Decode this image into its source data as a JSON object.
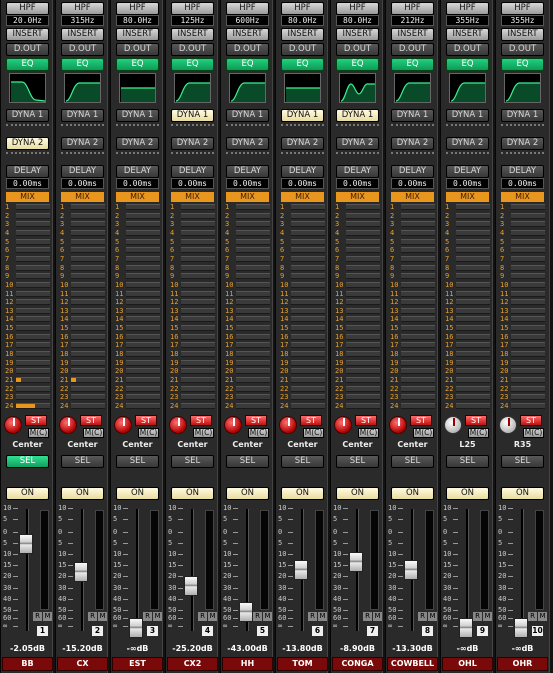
{
  "labels": {
    "hpf": "HPF",
    "insert": "INSERT",
    "dout": "D.OUT",
    "eq": "EQ",
    "dyna1": "DYNA 1",
    "dyna2": "DYNA 2",
    "delay": "DELAY",
    "mix": "MIX",
    "st": "ST",
    "mc": "M(C)",
    "sel": "SEL",
    "on": "ON",
    "r": "R",
    "m": "M"
  },
  "scale_marks": [
    "10",
    "5",
    "0",
    "5",
    "10",
    "15",
    "20",
    "30",
    "40",
    "50",
    "60",
    "∞"
  ],
  "send_numbers": [
    "1",
    "2",
    "3",
    "4",
    "5",
    "6",
    "7",
    "8",
    "9",
    "10",
    "11",
    "12",
    "13",
    "14",
    "15",
    "16",
    "17",
    "18",
    "19",
    "20",
    "21",
    "22",
    "23",
    "24"
  ],
  "colors": {
    "mix": "#e8961e",
    "eq_on": "#18b870",
    "sel_on": "#20c878",
    "st": "#e83030",
    "name_bg": "#7a0a0a"
  },
  "channels": [
    {
      "name": "BB",
      "number": "1",
      "hpf": "20.0Hz",
      "delay": "0.00ms",
      "pan": "Center",
      "level": "-2.05dB",
      "fader": 0.8,
      "eq_curve": "lowpass",
      "dyna1_on": false,
      "dyna2_on": true,
      "sel_on": true,
      "knob": "red",
      "sends": {
        "21": 0.15,
        "24": 0.55
      }
    },
    {
      "name": "CX",
      "number": "2",
      "hpf": "315Hz",
      "delay": "0.00ms",
      "pan": "Center",
      "level": "-15.20dB",
      "fader": 0.53,
      "eq_curve": "highpass",
      "dyna1_on": false,
      "dyna2_on": false,
      "sel_on": false,
      "knob": "red",
      "sends": {
        "21": 0.15
      }
    },
    {
      "name": "EST",
      "number": "3",
      "hpf": "80.0Hz",
      "delay": "0.00ms",
      "pan": "Center",
      "level": "-∞dB",
      "fader": 0.0,
      "eq_curve": "flat",
      "dyna1_on": false,
      "dyna2_on": false,
      "sel_on": false,
      "knob": "red",
      "sends": {}
    },
    {
      "name": "CX2",
      "number": "4",
      "hpf": "125Hz",
      "delay": "0.00ms",
      "pan": "Center",
      "level": "-25.20dB",
      "fader": 0.4,
      "eq_curve": "highpass",
      "dyna1_on": true,
      "dyna2_on": false,
      "sel_on": false,
      "knob": "red",
      "sends": {}
    },
    {
      "name": "HH",
      "number": "5",
      "hpf": "600Hz",
      "delay": "0.00ms",
      "pan": "Center",
      "level": "-43.00dB",
      "fader": 0.15,
      "eq_curve": "highpass",
      "dyna1_on": false,
      "dyna2_on": false,
      "sel_on": false,
      "knob": "red",
      "sends": {}
    },
    {
      "name": "TOM",
      "number": "6",
      "hpf": "80.0Hz",
      "delay": "0.00ms",
      "pan": "Center",
      "level": "-13.80dB",
      "fader": 0.55,
      "eq_curve": "flat",
      "dyna1_on": true,
      "dyna2_on": false,
      "sel_on": false,
      "knob": "red",
      "sends": {}
    },
    {
      "name": "CONGA",
      "number": "7",
      "hpf": "80.0Hz",
      "delay": "0.00ms",
      "pan": "Center",
      "level": "-8.90dB",
      "fader": 0.63,
      "eq_curve": "peak",
      "dyna1_on": true,
      "dyna2_on": false,
      "sel_on": false,
      "knob": "red",
      "sends": {}
    },
    {
      "name": "COWBELL",
      "number": "8",
      "hpf": "212Hz",
      "delay": "0.00ms",
      "pan": "Center",
      "level": "-13.30dB",
      "fader": 0.55,
      "eq_curve": "highpass",
      "dyna1_on": false,
      "dyna2_on": false,
      "sel_on": false,
      "knob": "red",
      "sends": {}
    },
    {
      "name": "OHL",
      "number": "9",
      "hpf": "355Hz",
      "delay": "0.00ms",
      "pan": "L25",
      "level": "-∞dB",
      "fader": 0.0,
      "eq_curve": "highpass",
      "dyna1_on": false,
      "dyna2_on": false,
      "sel_on": false,
      "knob": "grey",
      "sends": {}
    },
    {
      "name": "OHR",
      "number": "10",
      "hpf": "355Hz",
      "delay": "0.00ms",
      "pan": "R35",
      "level": "-∞dB",
      "fader": 0.0,
      "eq_curve": "highpass",
      "dyna1_on": false,
      "dyna2_on": false,
      "sel_on": false,
      "knob": "grey",
      "sends": {}
    }
  ]
}
